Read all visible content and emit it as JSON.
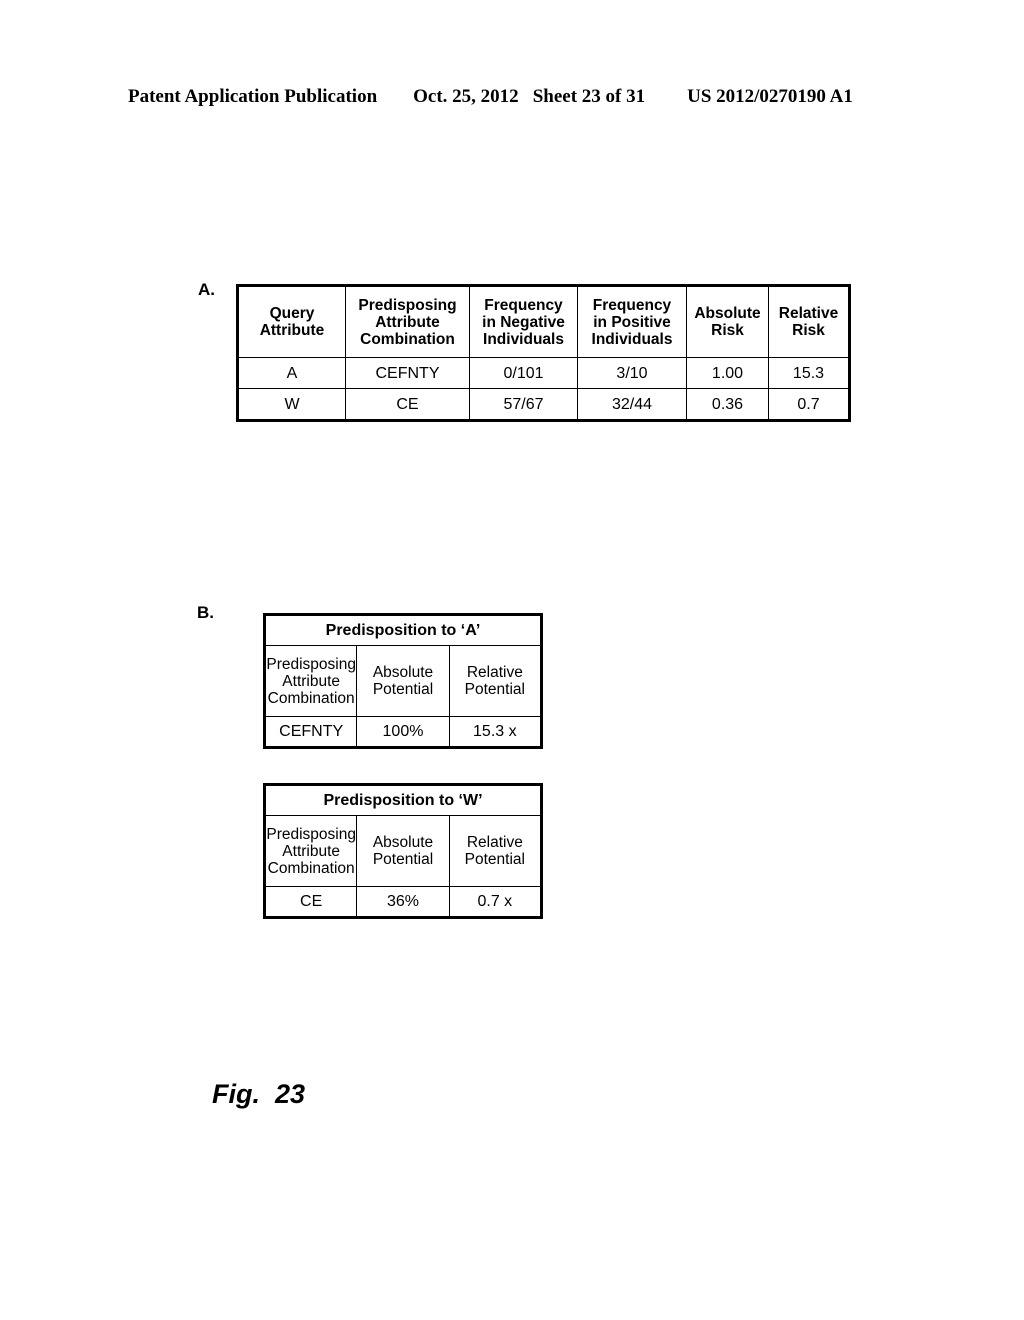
{
  "header": {
    "publication": "Patent Application Publication",
    "date": "Oct. 25, 2012",
    "sheet": "Sheet 23 of 31",
    "patent_number": "US 2012/0270190 A1"
  },
  "panel_a": {
    "label": "A.",
    "columns": [
      "Query\nAttribute",
      "Predisposing\nAttribute\nCombination",
      "Frequency\nin Negative\nIndividuals",
      "Frequency\nin Positive\nIndividuals",
      "Absolute\nRisk",
      "Relative\nRisk"
    ],
    "col_headers": {
      "query_attribute_l1": "Query",
      "query_attribute_l2": "Attribute",
      "predisposing_l1": "Predisposing",
      "predisposing_l2": "Attribute",
      "predisposing_l3": "Combination",
      "freq_neg_l1": "Frequency",
      "freq_neg_l2": "in Negative",
      "freq_neg_l3": "Individuals",
      "freq_pos_l1": "Frequency",
      "freq_pos_l2": "in Positive",
      "freq_pos_l3": "Individuals",
      "absolute_risk_l1": "Absolute",
      "absolute_risk_l2": "Risk",
      "relative_risk_l1": "Relative",
      "relative_risk_l2": "Risk"
    },
    "rows": [
      {
        "query_attribute": "A",
        "predisposing_attribute_combination": "CEFNTY",
        "frequency_in_negative_individuals": "0/101",
        "frequency_in_positive_individuals": "3/10",
        "absolute_risk": "1.00",
        "relative_risk": "15.3"
      },
      {
        "query_attribute": "W",
        "predisposing_attribute_combination": "CE",
        "frequency_in_negative_individuals": "57/67",
        "frequency_in_positive_individuals": "32/44",
        "absolute_risk": "0.36",
        "relative_risk": "0.7"
      }
    ]
  },
  "panel_b": {
    "label": "B.",
    "tables": [
      {
        "title": "Predisposition to ‘A’",
        "col_headers": {
          "combination_l1": "Predisposing",
          "combination_l2": "Attribute",
          "combination_l3": "Combination",
          "absolute_l1": "Absolute",
          "absolute_l2": "Potential",
          "relative_l1": "Relative",
          "relative_l2": "Potential"
        },
        "row": {
          "predisposing_attribute_combination": "CEFNTY",
          "absolute_potential": "100%",
          "relative_potential": "15.3 x"
        }
      },
      {
        "title": "Predisposition to ‘W’",
        "col_headers": {
          "combination_l1": "Predisposing",
          "combination_l2": "Attribute",
          "combination_l3": "Combination",
          "absolute_l1": "Absolute",
          "absolute_l2": "Potential",
          "relative_l1": "Relative",
          "relative_l2": "Potential"
        },
        "row": {
          "predisposing_attribute_combination": "CE",
          "absolute_potential": "36%",
          "relative_potential": "0.7 x"
        }
      }
    ]
  },
  "figure": {
    "caption": "Fig.  23"
  },
  "colors": {
    "ink": "#000000",
    "paper": "#ffffff"
  }
}
